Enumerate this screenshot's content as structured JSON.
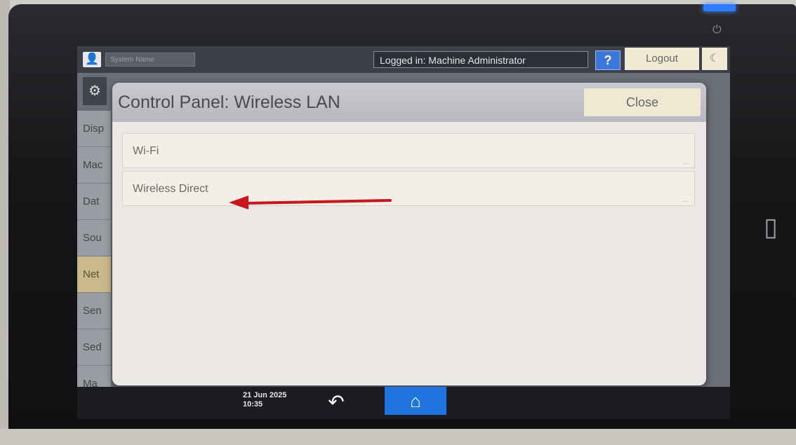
{
  "header": {
    "system_name": "System Name",
    "logged_in": "Logged in: Machine Administrator",
    "help_label": "?",
    "logout_label": "Logout",
    "moon_icon": "moon-icon"
  },
  "sidebar": {
    "items": [
      {
        "label": "Disp"
      },
      {
        "label": "Mac"
      },
      {
        "label": "Dat"
      },
      {
        "label": "Sou"
      },
      {
        "label": "Net",
        "active": true
      },
      {
        "label": "Sen"
      },
      {
        "label": "Sed"
      },
      {
        "label": "Ma"
      }
    ]
  },
  "dialog": {
    "title": "Control Panel: Wireless LAN",
    "close_label": "Close",
    "options": [
      {
        "label": "Wi-Fi"
      },
      {
        "label": "Wireless Direct"
      }
    ]
  },
  "footer": {
    "date": "21 Jun 2025",
    "time": "10:35"
  },
  "colors": {
    "accent_blue": "#1f74e0",
    "annotation_arrow": "#c8161d"
  }
}
